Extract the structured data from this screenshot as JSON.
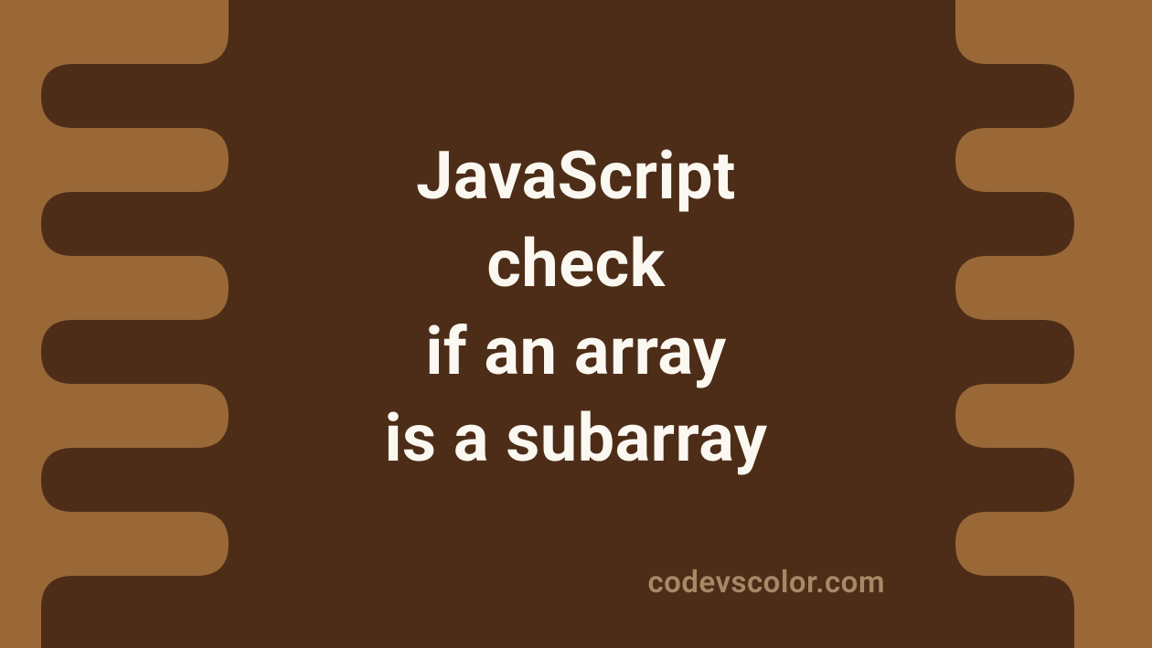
{
  "title": {
    "line1": "JavaScript",
    "line2": "check",
    "line3": "if an array",
    "line4": "is a subarray"
  },
  "credit": "codevscolor.com",
  "colors": {
    "bg_light": "#9a6837",
    "bg_dark": "#4d2d17",
    "text": "#fbf8f2",
    "credit": "#a88967"
  }
}
